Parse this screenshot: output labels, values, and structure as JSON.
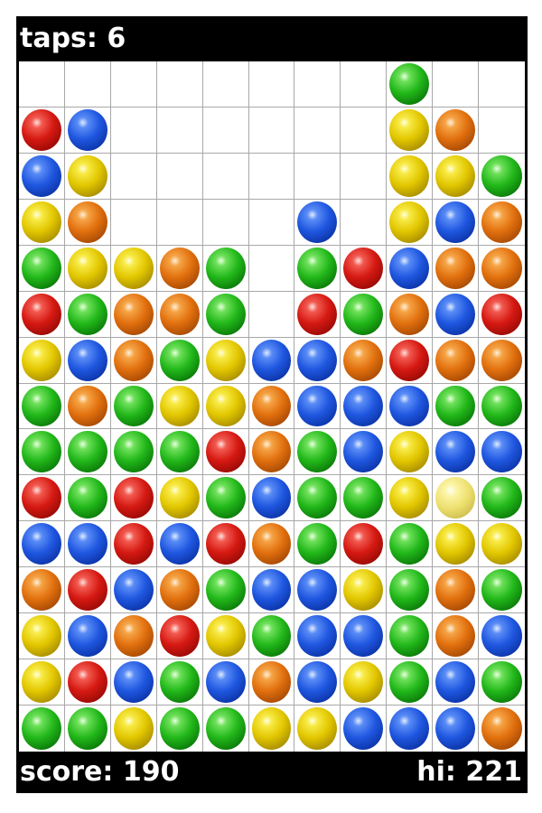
{
  "hud": {
    "taps_text": "taps: 6",
    "score_text": "score: 190",
    "hi_text": "hi: 221"
  },
  "board": {
    "columns": 11,
    "rows": 15,
    "cells": [
      [
        null,
        null,
        null,
        null,
        null,
        null,
        null,
        null,
        "green",
        null,
        null
      ],
      [
        "red",
        "blue",
        null,
        null,
        null,
        null,
        null,
        null,
        "yellow",
        "orange",
        null
      ],
      [
        "blue",
        "yellow",
        null,
        null,
        null,
        null,
        null,
        null,
        "yellow",
        "yellow",
        "green"
      ],
      [
        "yellow",
        "orange",
        null,
        null,
        null,
        null,
        "blue",
        null,
        "yellow",
        "blue",
        "orange"
      ],
      [
        "green",
        "yellow",
        "yellow",
        "orange",
        "green",
        null,
        "green",
        "red",
        "blue",
        "orange",
        "orange"
      ],
      [
        "red",
        "green",
        "orange",
        "orange",
        "green",
        null,
        "red",
        "green",
        "orange",
        "blue",
        "red"
      ],
      [
        "yellow",
        "blue",
        "orange",
        "green",
        "yellow",
        "blue",
        "blue",
        "orange",
        "red",
        "orange",
        "orange"
      ],
      [
        "green",
        "orange",
        "green",
        "yellow",
        "yellow",
        "orange",
        "blue",
        "blue",
        "blue",
        "green",
        "green"
      ],
      [
        "green",
        "green",
        "green",
        "green",
        "red",
        "orange",
        "green",
        "blue",
        "yellow",
        "blue",
        "blue"
      ],
      [
        "red",
        "green",
        "red",
        "yellow",
        "green",
        "blue",
        "green",
        "green",
        "yellow",
        "pale-yellow",
        "green"
      ],
      [
        "blue",
        "blue",
        "red",
        "blue",
        "red",
        "orange",
        "green",
        "red",
        "green",
        "yellow",
        "yellow"
      ],
      [
        "orange",
        "red",
        "blue",
        "orange",
        "green",
        "blue",
        "blue",
        "yellow",
        "green",
        "orange",
        "green"
      ],
      [
        "yellow",
        "blue",
        "orange",
        "red",
        "yellow",
        "green",
        "blue",
        "blue",
        "green",
        "orange",
        "blue"
      ],
      [
        "yellow",
        "red",
        "blue",
        "green",
        "blue",
        "orange",
        "blue",
        "yellow",
        "green",
        "blue",
        "green"
      ],
      [
        "green",
        "green",
        "yellow",
        "green",
        "green",
        "yellow",
        "yellow",
        "blue",
        "blue",
        "blue",
        "orange"
      ]
    ]
  },
  "colors": {
    "frame": "#000000",
    "hud_text": "#ffffff",
    "grid_line": "#a8a8a8",
    "board_bg": "#ffffff"
  }
}
